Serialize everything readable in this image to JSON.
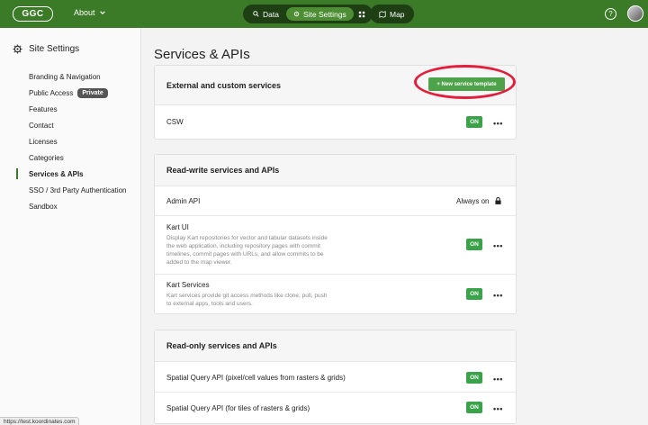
{
  "topbar": {
    "logo": "GGC",
    "about": "About",
    "tabs": [
      {
        "label": "Data"
      },
      {
        "label": "Site Settings"
      }
    ],
    "map": "Map",
    "help": "?"
  },
  "sidebar": {
    "title": "Site Settings",
    "items": [
      {
        "label": "Branding & Navigation"
      },
      {
        "label": "Public Access",
        "badge": "Private"
      },
      {
        "label": "Features"
      },
      {
        "label": "Contact"
      },
      {
        "label": "Licenses"
      },
      {
        "label": "Categories"
      },
      {
        "label": "Services & APIs"
      },
      {
        "label": "SSO / 3rd Party Authentication"
      },
      {
        "label": "Sandbox"
      }
    ]
  },
  "main": {
    "title": "Services & APIs",
    "external": {
      "header": "External and custom services",
      "button": "+ New service template",
      "rows": [
        {
          "label": "CSW",
          "status": "ON",
          "more": "•••"
        }
      ]
    },
    "readwrite": {
      "header": "Read-write services and APIs",
      "admin": {
        "label": "Admin API",
        "status": "Always on"
      },
      "rows": [
        {
          "label": "Kart UI",
          "desc": "Display Kart repositories for vector and tabular datasets inside the web application, including repository pages with commit timelines, commit pages with URLs, and allow commits to be added to the map viewer.",
          "status": "ON",
          "more": "•••"
        },
        {
          "label": "Kart Services",
          "desc": "Kart services provide git access methods like clone, pull, push to external apps, tools and users.",
          "status": "ON",
          "more": "•••"
        }
      ]
    },
    "readonly": {
      "header": "Read-only services and APIs",
      "rows": [
        {
          "label": "Spatial Query API (pixel/cell values from rasters & grids)",
          "status": "ON",
          "more": "•••"
        },
        {
          "label": "Spatial Query API (for tiles of rasters & grids)",
          "status": "ON",
          "more": "•••"
        }
      ]
    }
  },
  "statusbar": {
    "url": "https://test.koordinates.com"
  }
}
